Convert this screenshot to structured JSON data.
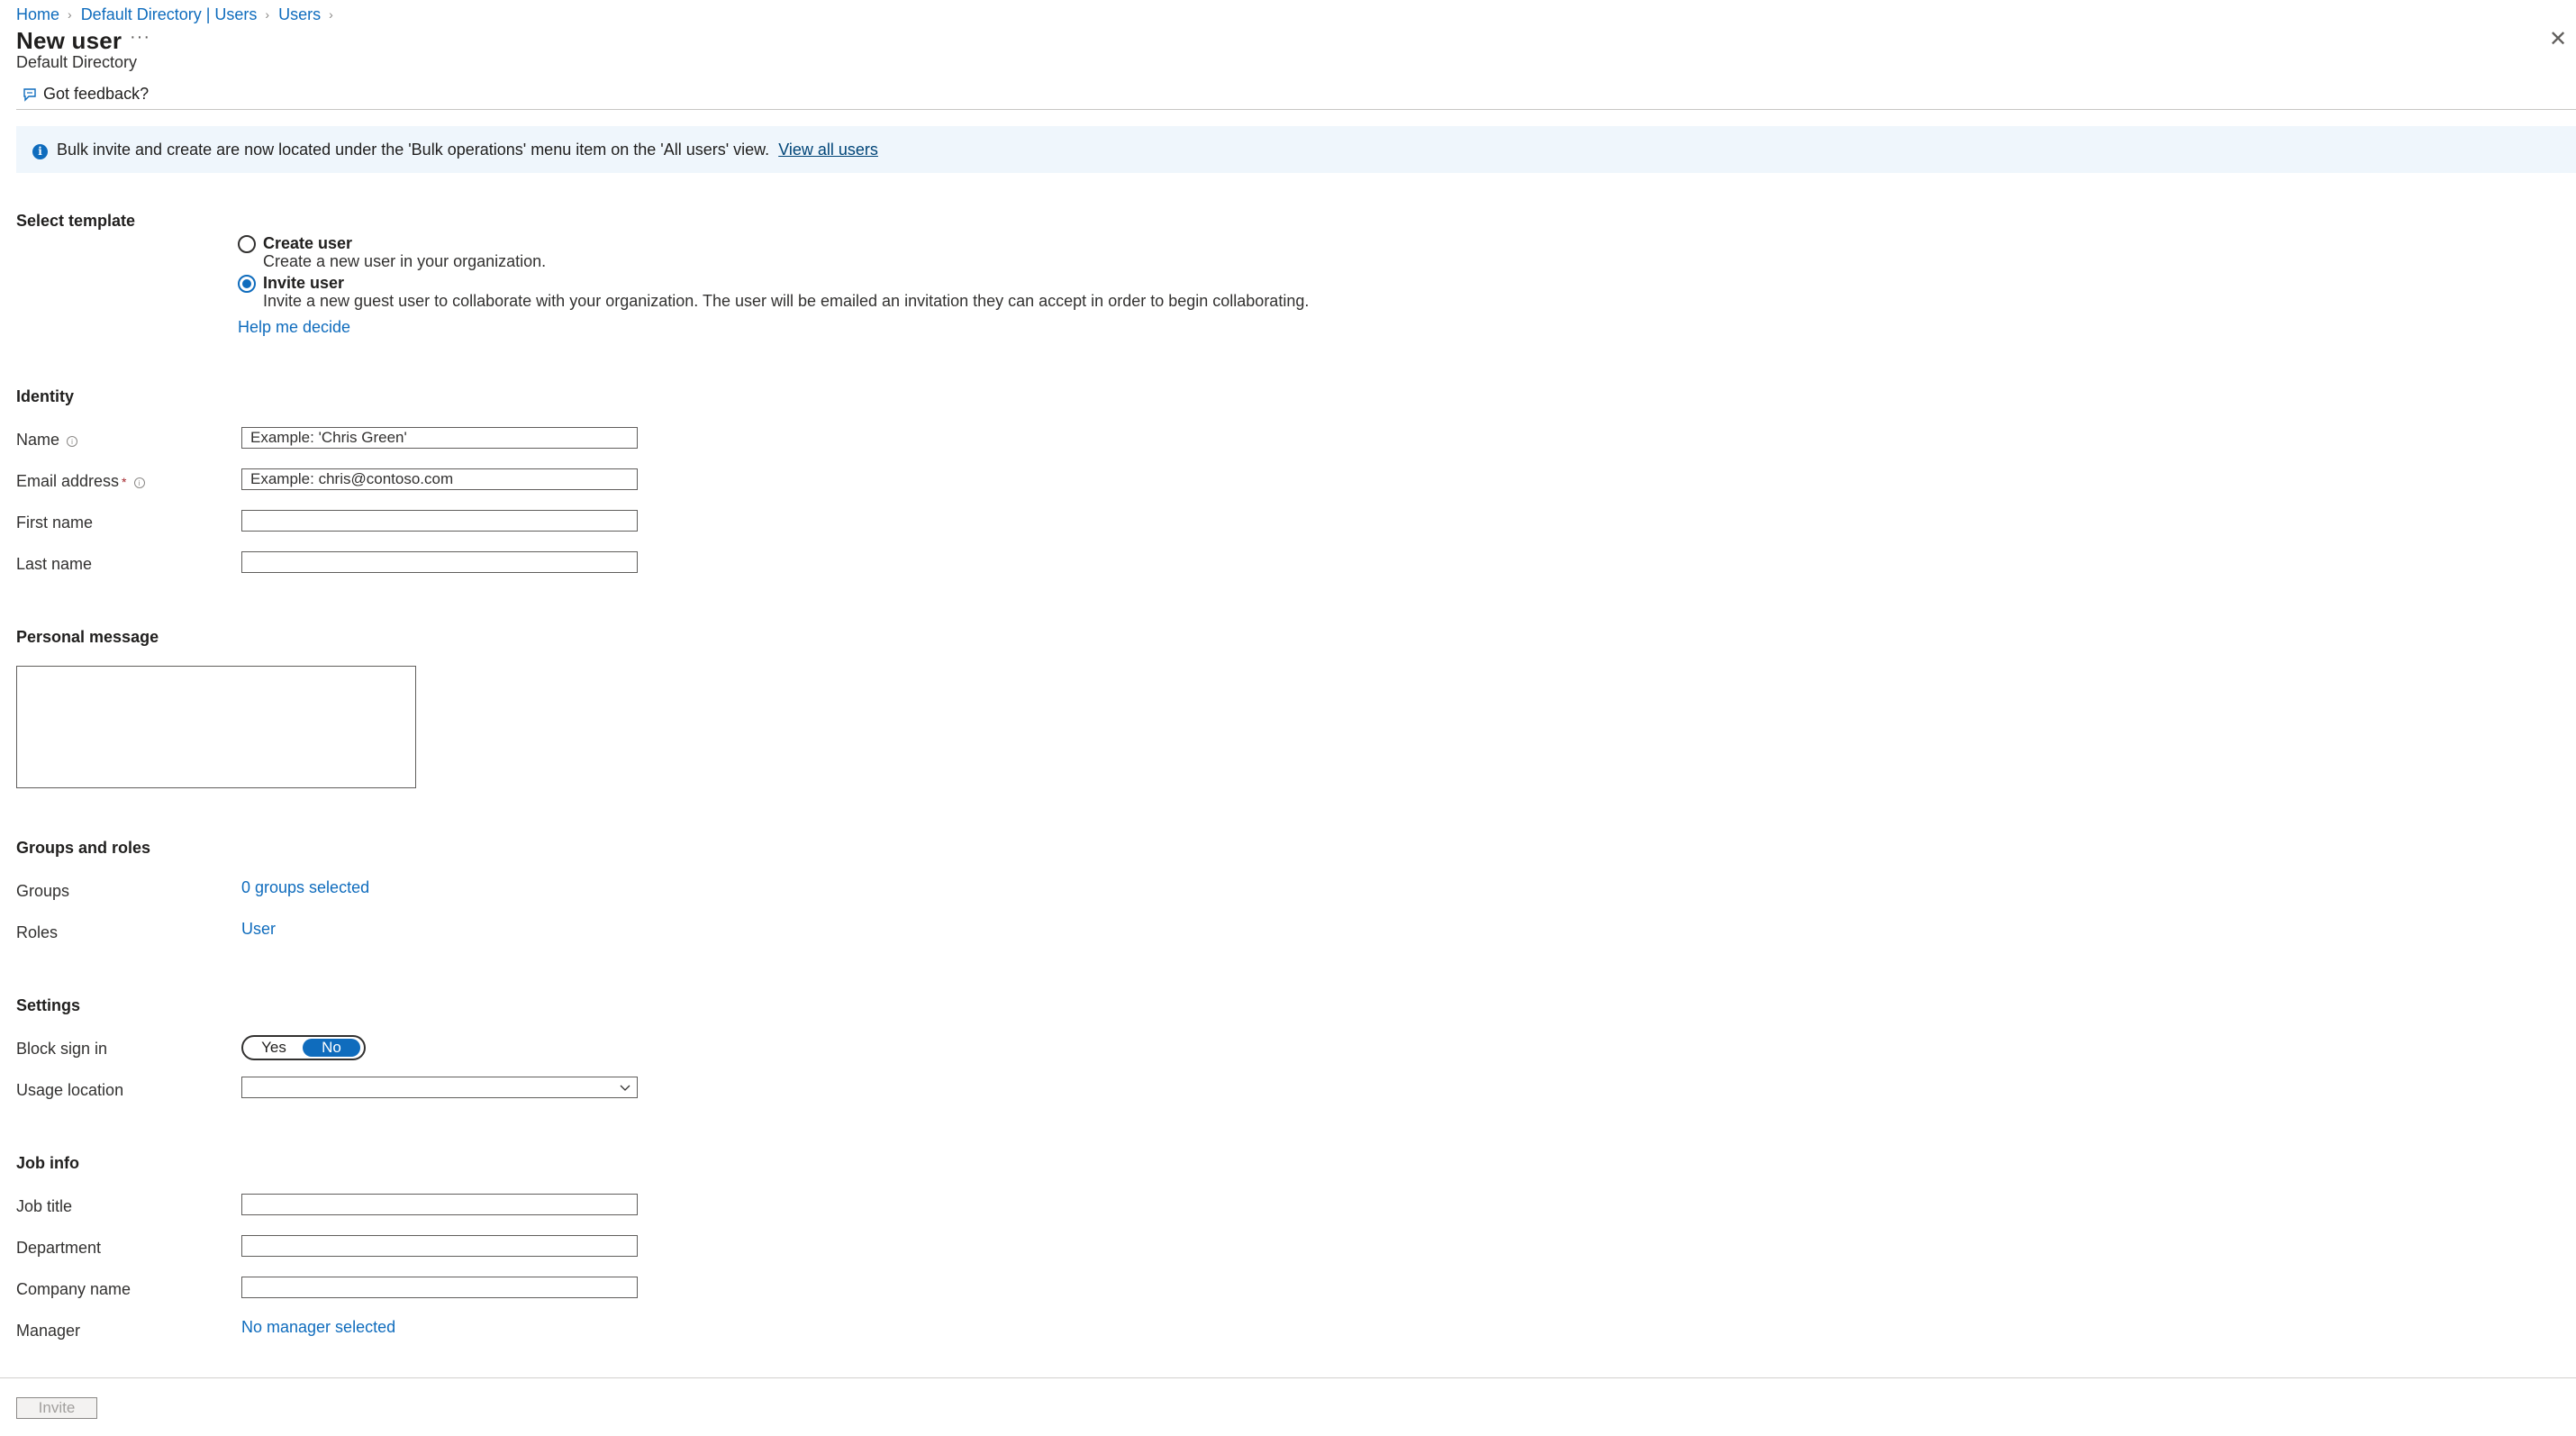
{
  "breadcrumb": [
    "Home",
    "Default Directory | Users",
    "Users"
  ],
  "header": {
    "title": "New user",
    "more": "···",
    "subtitle": "Default Directory",
    "close": "✕"
  },
  "toolbar": {
    "feedback_label": "Got feedback?"
  },
  "banner": {
    "info_glyph": "i",
    "text": "Bulk invite and create are now located under the 'Bulk operations' menu item on the 'All users' view.",
    "link": "View all users"
  },
  "template": {
    "heading": "Select template",
    "options": [
      {
        "title": "Create user",
        "desc": "Create a new user in your organization.",
        "selected": false
      },
      {
        "title": "Invite user",
        "desc": "Invite a new guest user to collaborate with your organization. The user will be emailed an invitation they can accept in order to begin collaborating.",
        "selected": true
      }
    ],
    "help_link": "Help me decide"
  },
  "identity": {
    "heading": "Identity",
    "name_label": "Name",
    "name_placeholder": "Example: 'Chris Green'",
    "email_label": "Email address",
    "email_required": "*",
    "email_placeholder": "Example: chris@contoso.com",
    "first_name_label": "First name",
    "last_name_label": "Last name"
  },
  "personal_message": {
    "heading": "Personal message"
  },
  "groups_roles": {
    "heading": "Groups and roles",
    "groups_label": "Groups",
    "groups_value": "0 groups selected",
    "roles_label": "Roles",
    "roles_value": "User"
  },
  "settings": {
    "heading": "Settings",
    "block_label": "Block sign in",
    "toggle_yes": "Yes",
    "toggle_no": "No",
    "toggle_selected": "No",
    "usage_label": "Usage location"
  },
  "job_info": {
    "heading": "Job info",
    "job_title_label": "Job title",
    "department_label": "Department",
    "company_label": "Company name",
    "manager_label": "Manager",
    "manager_value": "No manager selected"
  },
  "footer": {
    "invite_label": "Invite"
  },
  "colors": {
    "accent": "#0f6cbd",
    "banner_bg": "#eff6fc",
    "required": "#a4262c"
  }
}
